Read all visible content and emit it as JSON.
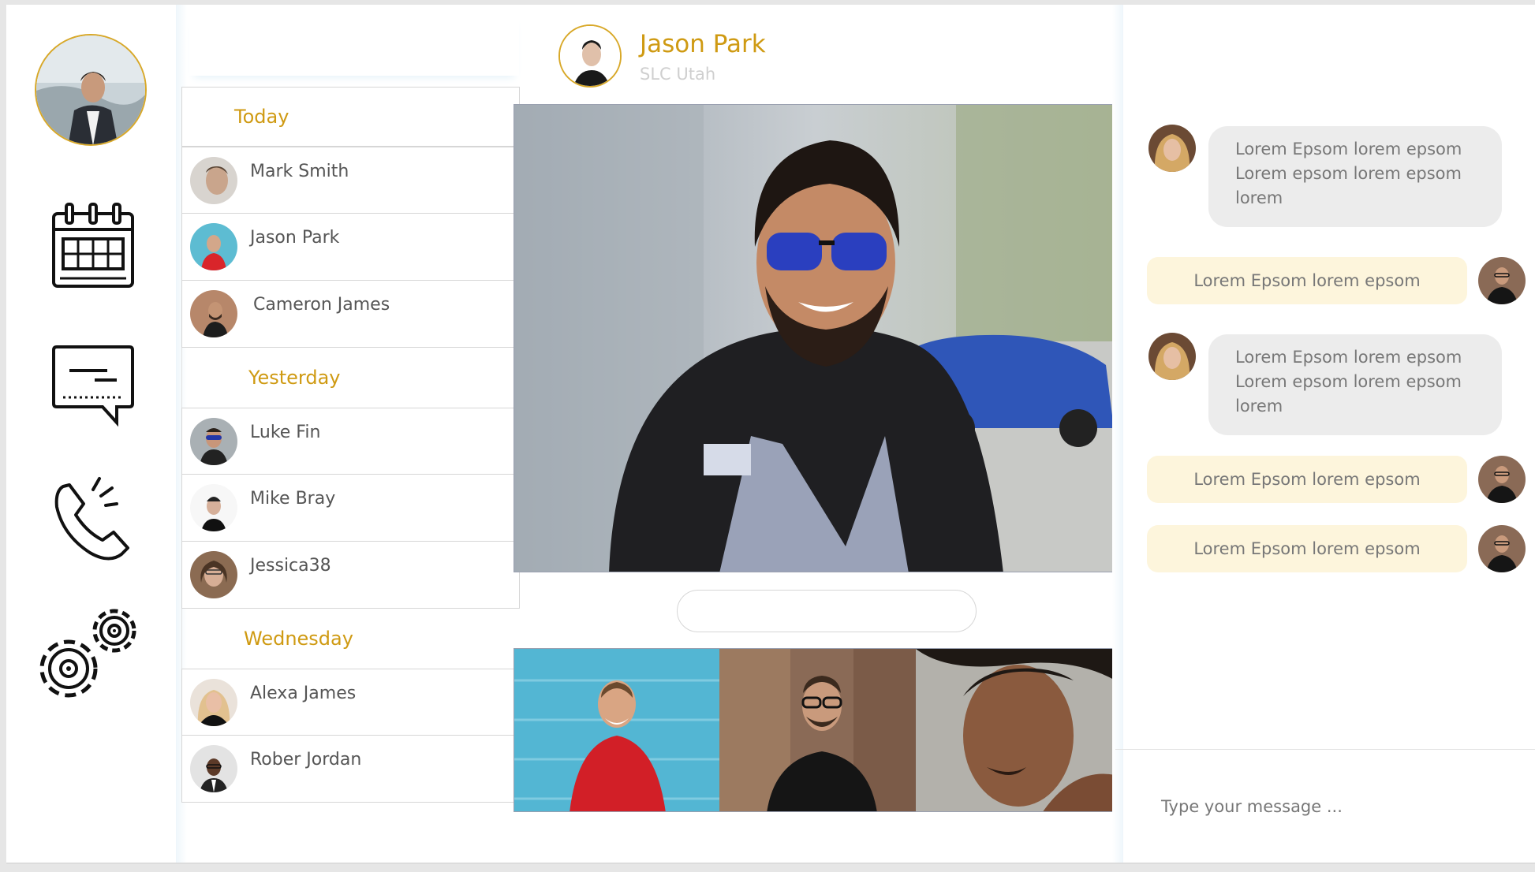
{
  "profile": {
    "icon": "user-avatar"
  },
  "nav": [
    {
      "name": "calendar-icon"
    },
    {
      "name": "chat-icon"
    },
    {
      "name": "phone-icon"
    },
    {
      "name": "settings-icon"
    }
  ],
  "contacts": {
    "groups": [
      {
        "label": "Today",
        "items": [
          {
            "name": "Mark Smith"
          },
          {
            "name": "Jason Park"
          },
          {
            "name": "Cameron James"
          }
        ]
      },
      {
        "label": "Yesterday",
        "items": [
          {
            "name": "Luke Fin"
          },
          {
            "name": "Mike Bray"
          },
          {
            "name": "Jessica38"
          }
        ]
      },
      {
        "label": "Wednesday",
        "items": [
          {
            "name": "Alexa James"
          },
          {
            "name": "Rober Jordan"
          }
        ]
      }
    ]
  },
  "header": {
    "name": "Jason Park",
    "location": "SLC Utah"
  },
  "messages": [
    {
      "type": "in",
      "lines": [
        "Lorem Epsom lorem epsom",
        "Lorem epsom lorem epsom",
        "lorem"
      ]
    },
    {
      "type": "out",
      "text": "Lorem Epsom lorem epsom"
    },
    {
      "type": "in",
      "lines": [
        "Lorem Epsom lorem epsom",
        "Lorem epsom lorem epsom",
        "lorem"
      ]
    },
    {
      "type": "out",
      "text": "Lorem Epsom lorem epsom"
    },
    {
      "type": "out",
      "text": "Lorem Epsom lorem epsom"
    }
  ],
  "compose": {
    "placeholder": "Type your message ..."
  },
  "colors": {
    "accent": "#cf9a12",
    "bubble_in": "#ececec",
    "bubble_out": "#fdf5dc"
  }
}
